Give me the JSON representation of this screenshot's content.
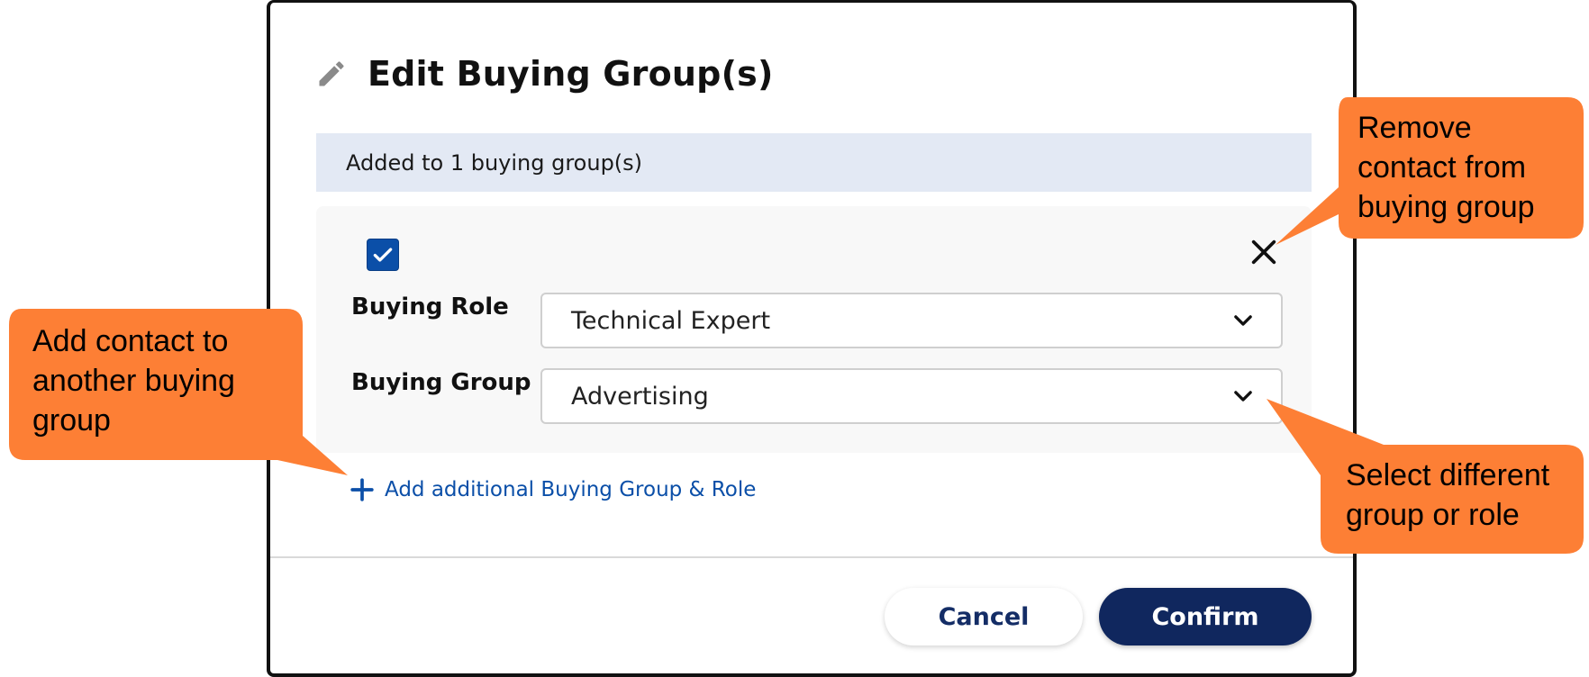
{
  "dialog": {
    "title": "Edit Buying Group(s)",
    "banner": "Added to 1 buying group(s)",
    "group_entry": {
      "checked": true,
      "role_label": "Buying Role",
      "role_value": "Technical Expert",
      "group_label": "Buying Group",
      "group_value": "Advertising"
    },
    "add_link_label": "Add additional Buying Group & Role",
    "cancel_label": "Cancel",
    "confirm_label": "Confirm"
  },
  "callouts": {
    "remove": [
      "Remove",
      "contact from",
      "buying group"
    ],
    "add": [
      "Add contact to",
      "another buying",
      "group"
    ],
    "select": [
      "Select different",
      "group or role"
    ]
  },
  "icons": {
    "title_icon": "pencil-icon",
    "checkbox_icon": "checkmark-icon",
    "close_icon": "close-icon",
    "dropdown_icon": "chevron-down-icon",
    "add_icon": "plus-icon"
  },
  "colors": {
    "primary": "#0b4fa8",
    "confirm_bg": "#10275e",
    "banner_bg": "#e3e9f4",
    "callout": "#fd7f35"
  }
}
